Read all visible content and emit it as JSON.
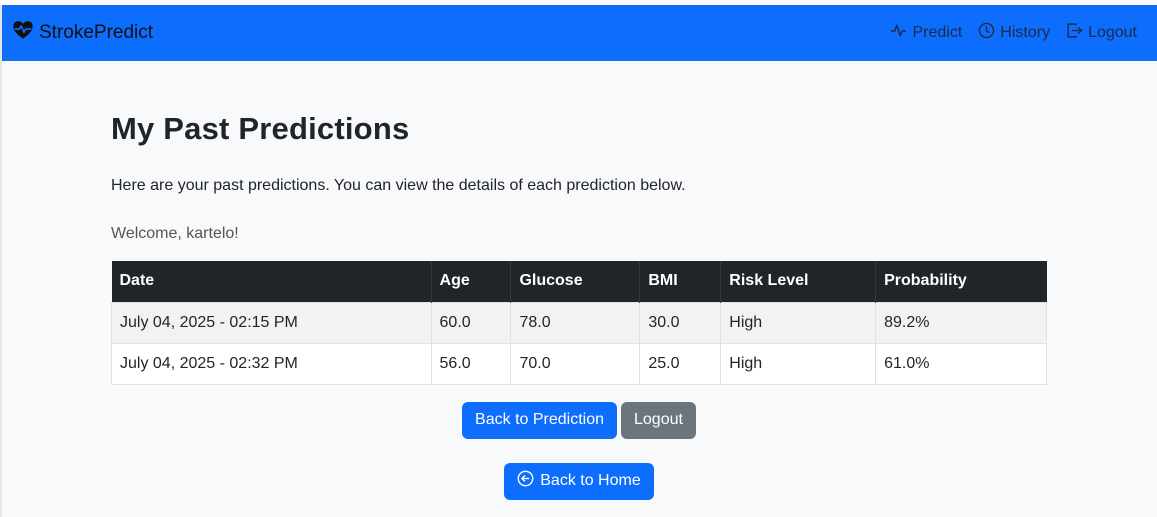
{
  "navbar": {
    "brand": "StrokePredict",
    "links": [
      {
        "label": "Predict",
        "icon": "activity-icon"
      },
      {
        "label": "History",
        "icon": "clock-icon"
      },
      {
        "label": "Logout",
        "icon": "logout-icon"
      }
    ],
    "color": "#0d6efd"
  },
  "main": {
    "title": "My Past Predictions",
    "intro": "Here are your past predictions. You can view the details of each prediction below.",
    "welcome": "Welcome, kartelo!"
  },
  "table": {
    "headers": [
      "Date",
      "Age",
      "Glucose",
      "BMI",
      "Risk Level",
      "Probability"
    ],
    "rows": [
      [
        "July 04, 2025 - 02:15 PM",
        "60.0",
        "78.0",
        "30.0",
        "High",
        "89.2%"
      ],
      [
        "July 04, 2025 - 02:32 PM",
        "56.0",
        "70.0",
        "25.0",
        "High",
        "61.0%"
      ]
    ]
  },
  "buttons": {
    "back_to_prediction": "Back to Prediction",
    "logout": "Logout",
    "back_to_home": "Back to Home"
  }
}
